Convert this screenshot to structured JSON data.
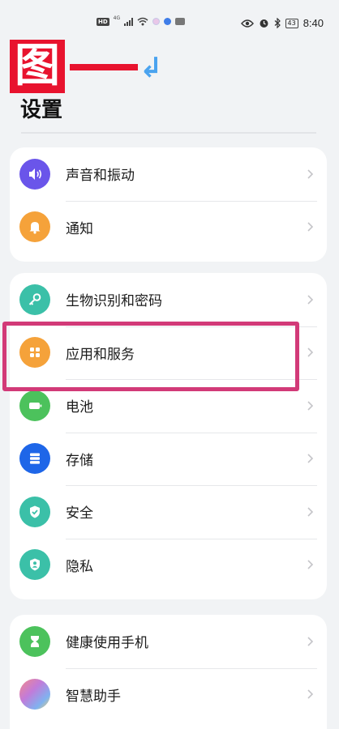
{
  "status_bar": {
    "left_indicators": [
      "HD",
      "4G"
    ],
    "time": "8:40",
    "battery": "43"
  },
  "annotation": {
    "glyph": "图",
    "arrow": "↲",
    "color": "#e8132e",
    "arrow_color": "#4aa3ef"
  },
  "page": {
    "title": "设置"
  },
  "groups": [
    {
      "items": [
        {
          "label": "声音和振动",
          "icon": "speaker-icon",
          "color": "#6a55ea"
        },
        {
          "label": "通知",
          "icon": "bell-icon",
          "color": "#f5a23a"
        }
      ]
    },
    {
      "items": [
        {
          "label": "生物识别和密码",
          "icon": "key-icon",
          "color": "#3bc0a8"
        },
        {
          "label": "应用和服务",
          "icon": "apps-grid-icon",
          "color": "#f5a23a"
        },
        {
          "label": "电池",
          "icon": "battery-icon",
          "color": "#4cc25c"
        },
        {
          "label": "存储",
          "icon": "storage-icon",
          "color": "#1e66e8"
        },
        {
          "label": "安全",
          "icon": "shield-check-icon",
          "color": "#3bc0a8"
        },
        {
          "label": "隐私",
          "icon": "privacy-shield-icon",
          "color": "#3bc0a8"
        }
      ]
    },
    {
      "items": [
        {
          "label": "健康使用手机",
          "icon": "hourglass-icon",
          "color": "#4cc25c"
        },
        {
          "label": "智慧助手",
          "icon": "assistant-orb-icon",
          "color": "#c27bd9"
        }
      ]
    }
  ],
  "highlight_color": "#d23a78"
}
